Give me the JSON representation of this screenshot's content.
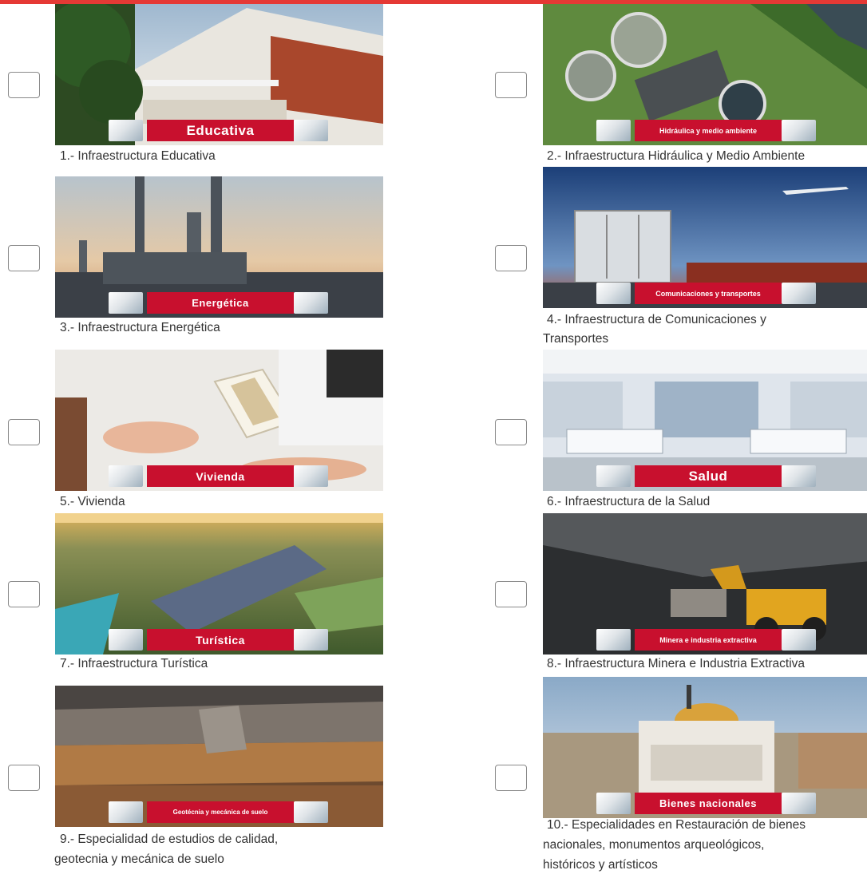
{
  "items": [
    {
      "badge": "Educativa",
      "caption": "1.- Infraestructura Educativa"
    },
    {
      "badge": "Hidráulica y medio ambiente",
      "caption": "2.- Infraestructura Hidráulica y Medio Ambiente"
    },
    {
      "badge": "Energética",
      "caption": "3.- Infraestructura Energética"
    },
    {
      "badge": "Comunicaciones y transportes",
      "caption_l1": "4.- Infraestructura de Comunicaciones y",
      "caption_l2": "Transportes"
    },
    {
      "badge": "Vivienda",
      "caption": "5.- Vivienda"
    },
    {
      "badge": "Salud",
      "caption": "6.- Infraestructura de la Salud"
    },
    {
      "badge": "Turística",
      "caption": "7.- Infraestructura Turística"
    },
    {
      "badge": "Minera e industria extractiva",
      "caption": "8.- Infraestructura Minera e Industria Extractiva"
    },
    {
      "badge": "Geotécnia y mecánica de suelo",
      "caption_l1": "9.- Especialidad de estudios de calidad,",
      "caption_l2": "geotecnia y mecánica de suelo"
    },
    {
      "badge": "Bienes nacionales",
      "caption_l1": "10.- Especialidades en Restauración de bienes",
      "caption_l2": "nacionales, monumentos arqueológicos,",
      "caption_l3": "históricos y artísticos"
    }
  ],
  "colors": {
    "accent": "#c8102e",
    "topbar": "#e53935"
  }
}
